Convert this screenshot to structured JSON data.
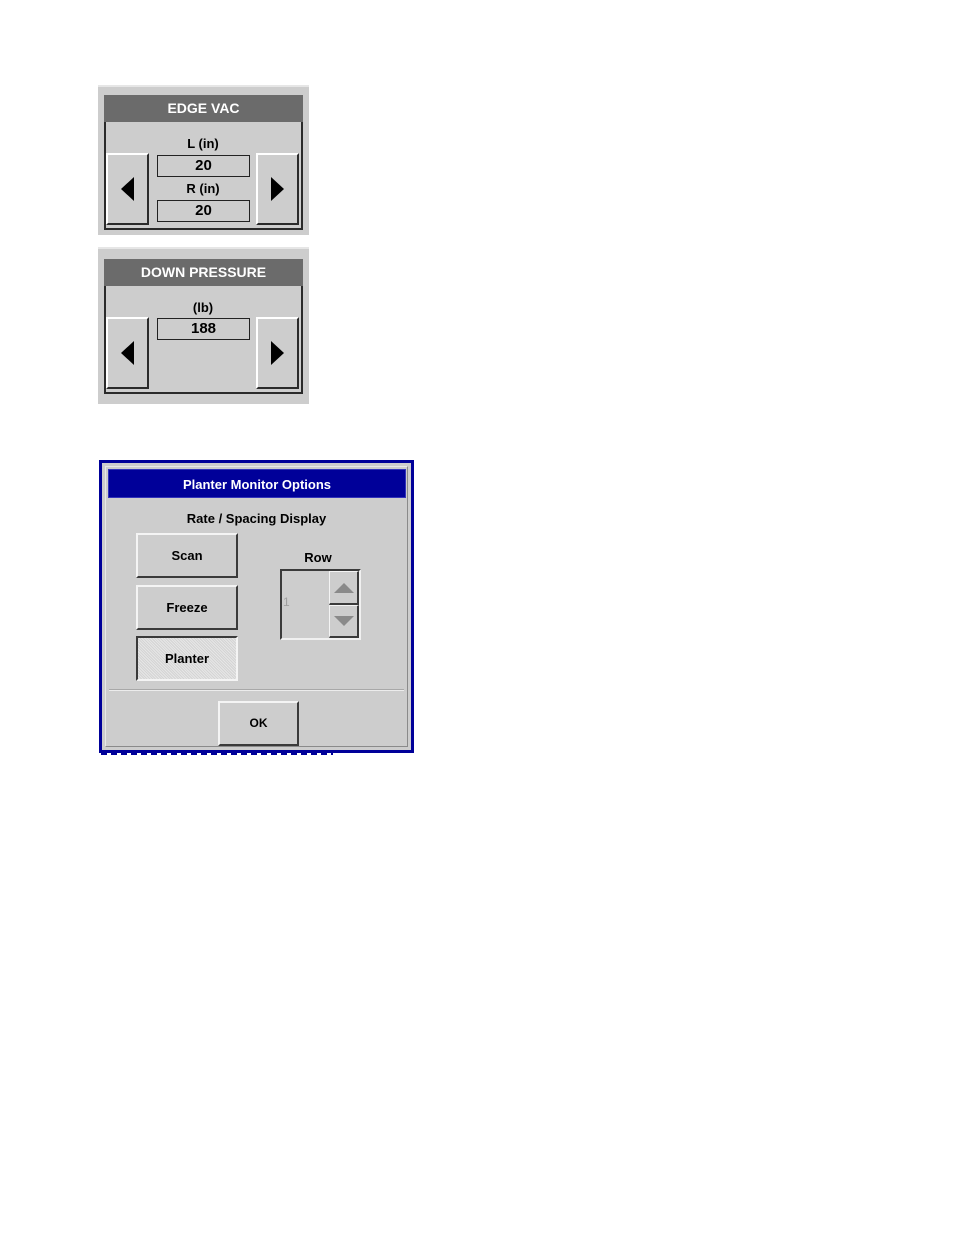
{
  "edge_vac": {
    "title": "EDGE VAC",
    "left_label": "L (in)",
    "left_value": "20",
    "right_label": "R (in)",
    "right_value": "20",
    "decrease_icon": "triangle-left",
    "increase_icon": "triangle-right"
  },
  "down_pressure": {
    "title": "DOWN PRESSURE",
    "unit_label": "(lb)",
    "value": "188",
    "decrease_icon": "triangle-left",
    "increase_icon": "triangle-right"
  },
  "dialog": {
    "title": "Planter Monitor Options",
    "section_label": "Rate / Spacing Display",
    "modes": [
      {
        "label": "Scan",
        "selected": false
      },
      {
        "label": "Freeze",
        "selected": false
      },
      {
        "label": "Planter",
        "selected": true
      }
    ],
    "row": {
      "label": "Row",
      "value": "1",
      "enabled": false,
      "up_icon": "triangle-up",
      "down_icon": "triangle-down"
    },
    "ok_label": "OK",
    "accent_color": "#000099"
  }
}
